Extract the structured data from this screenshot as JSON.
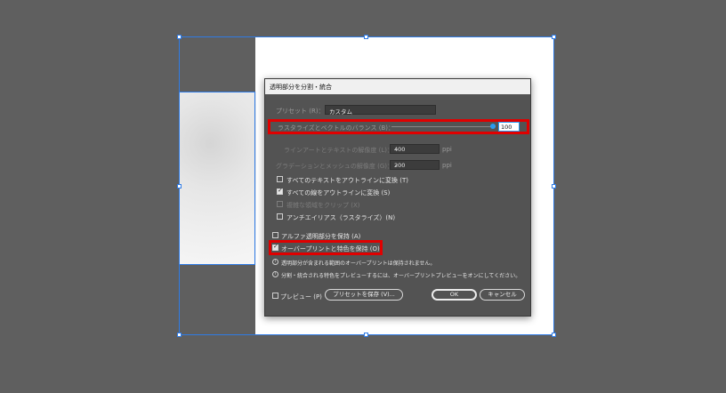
{
  "dialog": {
    "title": "透明部分を分割・統合",
    "preset": {
      "label": "プリセット (R)：",
      "value": "カスタム"
    },
    "balance": {
      "label": "ラスタライズとベクトルのバランス (B)：",
      "value": "100",
      "level": 1.0
    },
    "line_art_resolution": {
      "label": "ラインアートとテキストの解像度 (L)：",
      "value": "400",
      "unit": "ppi"
    },
    "gradient_mesh_resolution": {
      "label": "グラデーションとメッシュの解像度 (G)：",
      "value": "200",
      "unit": "ppi"
    },
    "checkboxes": [
      {
        "label": "すべてのテキストをアウトラインに変換 (T)",
        "checked": false,
        "disabled": false
      },
      {
        "label": "すべての線をアウトラインに変換 (S)",
        "checked": true,
        "disabled": false
      },
      {
        "label": "複雑な領域をクリップ (X)",
        "checked": false,
        "disabled": true
      },
      {
        "label": "アンチエイリアス（ラスタライズ）(N)",
        "checked": false,
        "disabled": false
      }
    ],
    "preserve_alpha": {
      "label": "アルファ透明部分を保持 (A)",
      "checked": false
    },
    "preserve_overprint": {
      "label": "オーバープリントと特色を保持 (O)",
      "checked": true
    },
    "info1": "透明部分が含まれる範囲のオーバープリントは保持されません。",
    "info2": "分割・統合される特色をプレビューするには、オーバープリントプレビューをオンにしてください。",
    "preview_label": "プレビュー (P)",
    "save_preset_label": "プリセットを保存 (V)...",
    "ok_label": "OK",
    "cancel_label": "キャンセル"
  },
  "colors": {
    "highlight": "#e00000",
    "selection": "#2f7be5",
    "slider_thumb": "#2a9bf0"
  }
}
